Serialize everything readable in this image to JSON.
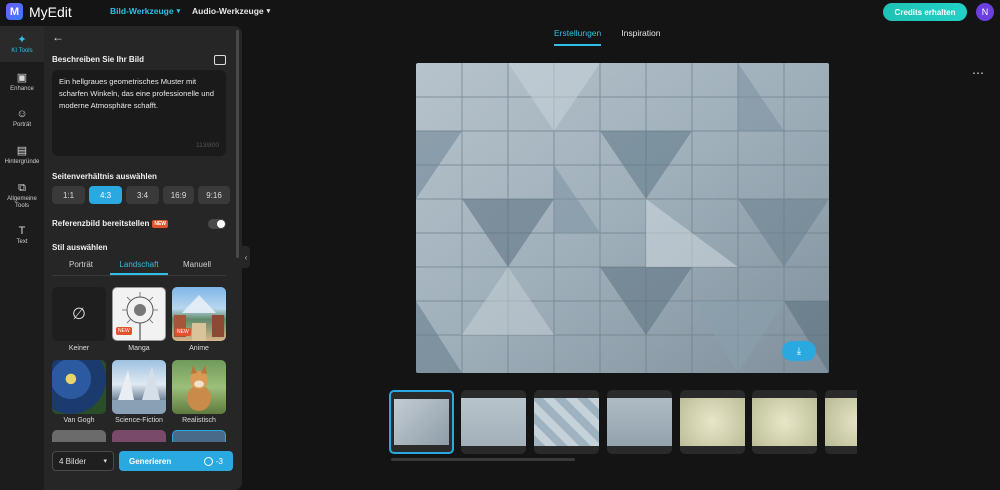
{
  "app": {
    "name": "MyEdit",
    "logo_letter": "M"
  },
  "topnav": {
    "image_tools": "Bild-Werkzeuge",
    "audio_tools": "Audio-Werkzeuge"
  },
  "header": {
    "credits_button": "Credits erhalten",
    "avatar_initial": "N"
  },
  "rail": [
    {
      "label": "KI Tools",
      "icon": "magic-wand-icon",
      "active": true
    },
    {
      "label": "Enhance",
      "icon": "enhance-icon"
    },
    {
      "label": "Porträt",
      "icon": "portrait-icon"
    },
    {
      "label": "Hintergründe",
      "icon": "background-icon"
    },
    {
      "label": "Allgemeine Tools",
      "icon": "tools-icon"
    },
    {
      "label": "Text",
      "icon": "text-icon"
    }
  ],
  "panel": {
    "describe_label": "Beschreiben Sie Ihr Bild",
    "prompt_text": "Ein hellgraues geometrisches Muster mit scharfen Winkeln, das eine professionelle und moderne Atmosphäre schafft.",
    "char_counter": "113/800",
    "ratio_label": "Seitenverhältnis auswählen",
    "ratios": [
      "1:1",
      "4:3",
      "3:4",
      "16:9",
      "9:16"
    ],
    "ratio_selected": "4:3",
    "reference_label": "Referenzbild bereitstellen",
    "new_badge": "NEW",
    "reference_enabled": false,
    "style_label": "Stil auswählen",
    "style_tabs": [
      "Porträt",
      "Landschaft",
      "Manuell"
    ],
    "style_tab_active": "Landschaft",
    "styles": [
      {
        "label": "Keiner",
        "new": false
      },
      {
        "label": "Manga",
        "new": true
      },
      {
        "label": "Anime",
        "new": true
      },
      {
        "label": "Van Gogh",
        "new": false
      },
      {
        "label": "Science-Fiction",
        "new": false
      },
      {
        "label": "Realistisch",
        "new": false
      }
    ],
    "none_symbol": "∅",
    "image_count": "4 Bilder",
    "generate_label": "Generieren",
    "generate_cost": "-3"
  },
  "main": {
    "tabs": [
      "Erstellungen",
      "Inspiration"
    ],
    "tab_active": "Erstellungen"
  },
  "colors": {
    "accent": "#29a9e0",
    "credits": "#1fc2b3",
    "avatar": "#6b3fe0",
    "badge_new": "#e0532c"
  }
}
